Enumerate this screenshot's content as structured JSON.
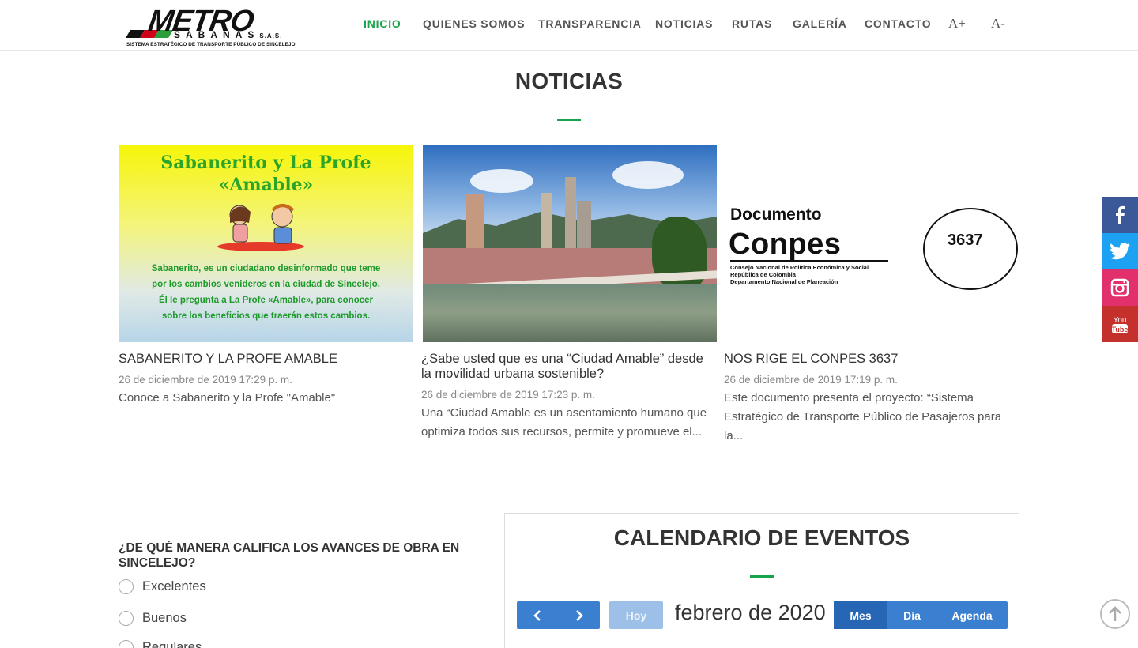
{
  "header": {
    "logo": {
      "brand": "METRO",
      "sub": "SABANAS",
      "suffix": "S.A.S.",
      "tagline": "SISTEMA ESTRATÉGICO DE TRANSPORTE PÚBLICO DE SINCELEJO"
    },
    "nav": [
      {
        "label": "INICIO",
        "active": true
      },
      {
        "label": "QUIENES SOMOS",
        "active": false
      },
      {
        "label": "TRANSPARENCIA",
        "active": false
      },
      {
        "label": "NOTICIAS",
        "active": false
      },
      {
        "label": "RUTAS",
        "active": false
      },
      {
        "label": "GALERÍA",
        "active": false
      },
      {
        "label": "CONTACTO",
        "active": false
      }
    ],
    "font_increase": "A+",
    "font_decrease": "A-"
  },
  "news": {
    "title": "NOTICIAS",
    "cards": [
      {
        "title": "SABANERITO Y LA PROFE AMABLE",
        "date": "26 de diciembre de 2019 17:29 p. m.",
        "excerpt": "Conoce a Sabanerito y la Profe \"Amable\"",
        "image_heading": "Sabanerito y La Profe «Amable»",
        "image_text": "Sabanerito, es un ciudadano desinformado que teme por los cambios venideros en la ciudad de Sincelejo. Él le pregunta a La Profe «Amable», para conocer sobre los beneficios que traerán estos cambios."
      },
      {
        "title": "¿Sabe usted que es una “Ciudad Amable” desde la movilidad urbana sostenible?",
        "date": "26 de diciembre de 2019 17:23 p. m.",
        "excerpt": "Una “Ciudad Amable es un asentamiento humano que optimiza todos sus recursos, permite y promueve el..."
      },
      {
        "title": "NOS RIGE EL CONPES 3637",
        "date": "26 de diciembre de 2019 17:19 p. m.",
        "excerpt": "Este documento presenta el proyecto: “Sistema Estratégico de Transporte Público de Pasajeros para la...",
        "image_doc": "Documento",
        "image_conpes": "Conpes",
        "image_small1": "Consejo Nacional de Política Económica y Social",
        "image_small2": "República de Colombia",
        "image_small3": "Departamento Nacional de Planeación",
        "image_number": "3637"
      }
    ]
  },
  "social": [
    "facebook-icon",
    "twitter-icon",
    "instagram-icon",
    "youtube-icon"
  ],
  "poll": {
    "question": "¿DE QUÉ MANERA CALIFICA LOS AVANCES DE OBRA EN SINCELEJO?",
    "options": [
      "Excelentes",
      "Buenos",
      "Regulares"
    ]
  },
  "calendar": {
    "title": "CALENDARIO DE EVENTOS",
    "today": "Hoy",
    "month": "febrero de 2020",
    "views": [
      {
        "label": "Mes",
        "active": true
      },
      {
        "label": "Día",
        "active": false
      },
      {
        "label": "Agenda",
        "active": false
      }
    ]
  },
  "colors": {
    "accent": "#19a34a",
    "calendar_blue": "#3a7fd0",
    "facebook": "#3b5998",
    "twitter": "#1da1f2",
    "instagram": "#e1306c",
    "youtube": "#c4302b"
  }
}
